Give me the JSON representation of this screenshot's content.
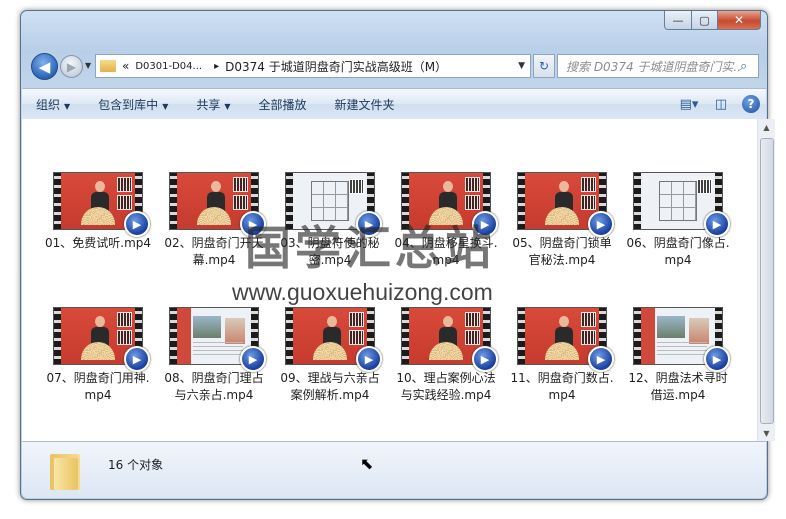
{
  "window": {
    "caption_buttons": {
      "minimize": "—",
      "maximize": "▢",
      "close": "✕"
    }
  },
  "nav": {
    "back_glyph": "◀",
    "forward_glyph": "▶",
    "history_glyph": "▼",
    "breadcrumb_overflow": "«",
    "breadcrumb": [
      "D0301-D04...",
      "D0374 于城道阴盘奇门实战高级班（M）"
    ],
    "breadcrumb_sep": "▸",
    "address_dropdown": "▼",
    "refresh_glyph": "↻",
    "search_placeholder": "搜索 D0374 于城道阴盘奇门实..."
  },
  "toolbar": {
    "items": [
      {
        "label": "组织",
        "arrow": "▼"
      },
      {
        "label": "包含到库中",
        "arrow": "▼"
      },
      {
        "label": "共享",
        "arrow": "▼"
      },
      {
        "label": "全部播放",
        "arrow": ""
      },
      {
        "label": "新建文件夹",
        "arrow": ""
      }
    ],
    "help": "?"
  },
  "files": [
    {
      "name": "01、免费试听.mp4",
      "thumb": "lecture"
    },
    {
      "name": "02、阴盘奇门开天幕.mp4",
      "thumb": "lecture"
    },
    {
      "name": "03、阴盘符使的秘密.mp4",
      "thumb": "grid"
    },
    {
      "name": "04、阴盘移星换斗.mp4",
      "thumb": "lecture"
    },
    {
      "name": "05、阴盘奇门锁单官秘法.mp4",
      "thumb": "lecture"
    },
    {
      "name": "06、阴盘奇门像占.mp4",
      "thumb": "grid"
    },
    {
      "name": "07、阴盘奇门用神.mp4",
      "thumb": "lecture"
    },
    {
      "name": "08、阴盘奇门理占与六亲占.mp4",
      "thumb": "photo"
    },
    {
      "name": "09、理战与六亲占案例解析.mp4",
      "thumb": "lecture"
    },
    {
      "name": "10、理占案例心法与实践经验.mp4",
      "thumb": "lecture"
    },
    {
      "name": "11、阴盘奇门数占.mp4",
      "thumb": "lecture"
    },
    {
      "name": "12、阴盘法术寻时借运.mp4",
      "thumb": "photo"
    }
  ],
  "status": {
    "count_text": "16 个对象"
  },
  "watermark": {
    "text": "国学汇总站",
    "url": "www.guoxuehuizong.com"
  }
}
